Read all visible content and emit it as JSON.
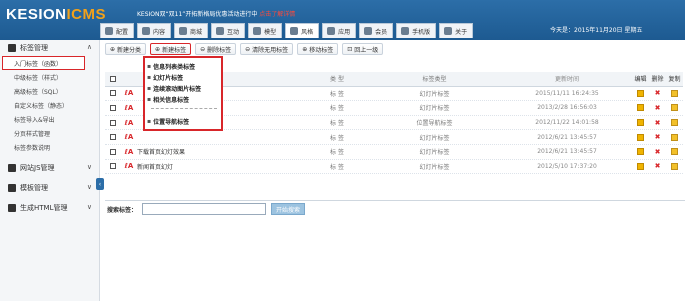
{
  "header": {
    "logo_main": "KESION",
    "logo_accent": "ICMS",
    "promo_text": "KESION双“双11”开拓新格局优惠活动进行中",
    "promo_highlight": "点击了解详情",
    "date": "今天是：2015年11月20日 星期五",
    "nav": [
      {
        "label": "配置",
        "icon": "gear-icon"
      },
      {
        "label": "内容",
        "icon": "document-icon"
      },
      {
        "label": "商城",
        "icon": "store-icon"
      },
      {
        "label": "互动",
        "icon": "chat-icon"
      },
      {
        "label": "模型",
        "icon": "grid-icon"
      },
      {
        "label": "风格",
        "icon": "tag-icon",
        "active": true
      },
      {
        "label": "应用",
        "icon": "monitor-icon"
      },
      {
        "label": "会员",
        "icon": "user-icon"
      },
      {
        "label": "手机版",
        "icon": "mobile-icon"
      },
      {
        "label": "关于",
        "icon": "menu-icon"
      }
    ]
  },
  "sidebar": {
    "sections": [
      {
        "label": "标签管理",
        "icon": "tag-icon",
        "expanded": true
      },
      {
        "label": "网站JS管理",
        "icon": "code-icon"
      },
      {
        "label": "模板管理",
        "icon": "template-icon"
      },
      {
        "label": "生成HTML管理",
        "icon": "list-icon"
      }
    ],
    "items": [
      {
        "label": "入门标签（函数）",
        "active": true
      },
      {
        "label": "中级标签（样式）"
      },
      {
        "label": "高级标签（SQL）"
      },
      {
        "label": "自定义标签（静态）"
      },
      {
        "label": "标签导入&导出"
      },
      {
        "label": "分页样式管理"
      },
      {
        "label": "标签参数说明"
      }
    ]
  },
  "toolbar": {
    "buttons": [
      "新建分类",
      "新建标签",
      "删除标签",
      "清除无用标签",
      "移动标签",
      "回上一级"
    ]
  },
  "dropdown": {
    "items": [
      "信息列表类标签",
      "幻灯片标签",
      "连续滚动图片标签",
      "相关信息标签"
    ],
    "extra": "位置导航标签"
  },
  "table": {
    "headers": [
      "名称",
      "类 型",
      "标签类型",
      "更新时间",
      "编辑",
      "删除",
      "复制"
    ],
    "rows": [
      {
        "name": "",
        "type": "标 签",
        "ltype": "幻灯片标签",
        "time": "2015/11/11 16:24:35"
      },
      {
        "name": "",
        "type": "标 签",
        "ltype": "幻灯片标签",
        "time": "2013/2/28 16:56:03"
      },
      {
        "name": "",
        "type": "标 签",
        "ltype": "位置导航标签",
        "time": "2012/11/22 14:01:58"
      },
      {
        "name": "",
        "type": "标 签",
        "ltype": "幻灯片标签",
        "time": "2012/6/21 13:45:57"
      },
      {
        "name": "下载首页幻灯效果",
        "type": "标 签",
        "ltype": "幻灯片标签",
        "time": "2012/6/21 13:45:57"
      },
      {
        "name": "新闻首页幻灯",
        "type": "标 签",
        "ltype": "幻灯片标签",
        "time": "2012/5/10 17:37:20"
      }
    ]
  },
  "search": {
    "label": "搜索标签：",
    "placeholder": "",
    "button": "开始搜索"
  },
  "colors": {
    "header_blue": "#2c6ea8",
    "highlight_red": "#d8262a"
  }
}
